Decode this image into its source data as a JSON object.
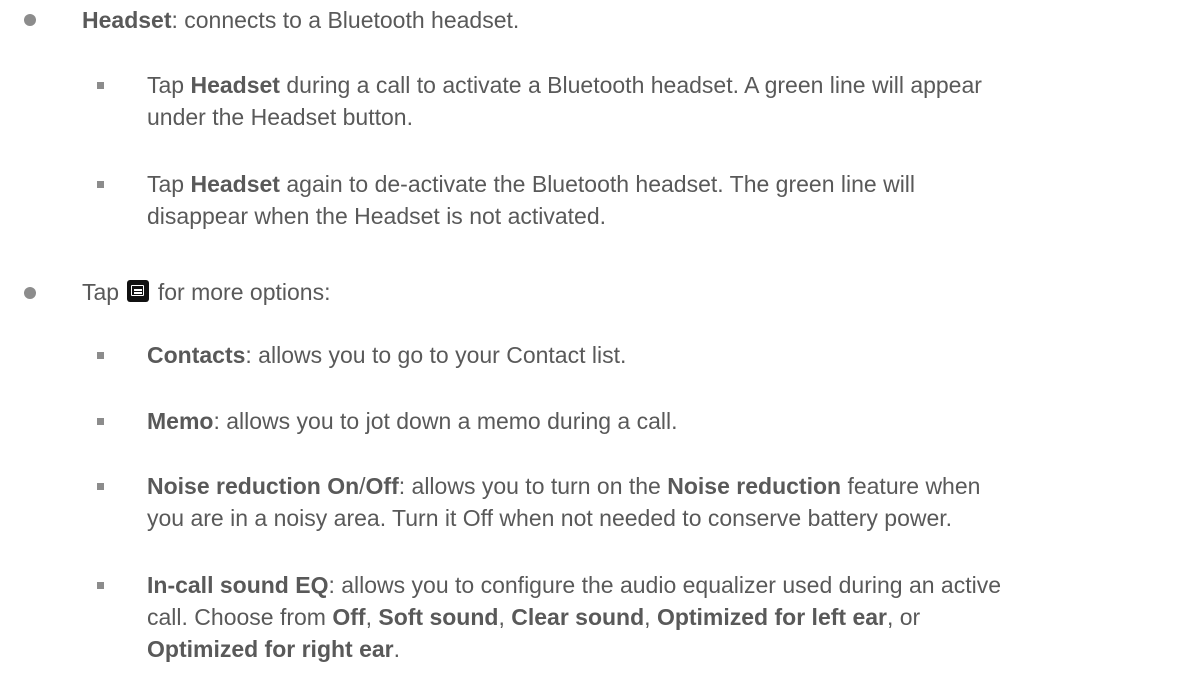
{
  "headset_item": {
    "term": "Headset",
    "desc": ": connects to a Bluetooth headset."
  },
  "headset_sub1": {
    "prefix": "Tap ",
    "term": "Headset",
    "line1_rest": " during a call to activate a Bluetooth headset. A green line will appear",
    "line2": "under the Headset button."
  },
  "headset_sub2": {
    "prefix": "Tap ",
    "term": "Headset",
    "line1_rest": " again to de-activate the Bluetooth headset. The green line will",
    "line2": "disappear when the Headset is not activated."
  },
  "menu_item": {
    "prefix": "Tap ",
    "icon": "menu-icon",
    "suffix": " for more options:"
  },
  "contacts_item": {
    "term": "Contacts",
    "desc": ": allows you to go to your Contact list."
  },
  "memo_item": {
    "term": "Memo",
    "desc": ": allows you to jot down a memo during a call."
  },
  "noise_item": {
    "term_a": "Noise reduction On",
    "slash": "/",
    "term_b": "Off",
    "desc_a": ": allows you to turn on the ",
    "term_c": "Noise reduction",
    "desc_b": " feature when",
    "line2": "you are in a noisy area. Turn it Off when not needed to conserve battery power."
  },
  "eq_item": {
    "term": "In-call sound EQ",
    "line1_rest": ": allows you to configure the audio equalizer used during an active",
    "line2_a": "call. Choose from ",
    "opt1": "Off",
    "sep1": ", ",
    "opt2": "Soft sound",
    "sep2": ", ",
    "opt3": "Clear sound",
    "sep3": ", ",
    "opt4": "Optimized for left ear",
    "sep4": ", or",
    "opt5": "Optimized for right ear",
    "end": "."
  }
}
